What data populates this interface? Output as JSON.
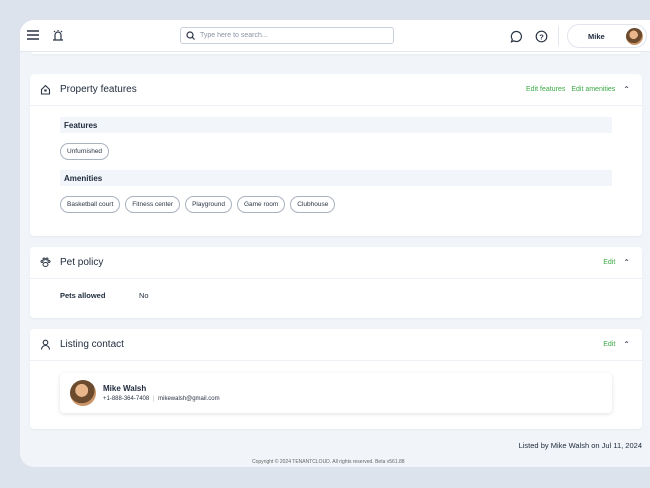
{
  "header": {
    "search_placeholder": "Type here to search...",
    "user_name": "Mike",
    "icons": [
      "menu-icon",
      "alarm-bell-icon",
      "search-icon",
      "chat-icon",
      "help-icon"
    ]
  },
  "property_features": {
    "title": "Property features",
    "edit_features": "Edit features",
    "edit_amenities": "Edit amenities",
    "features_label": "Features",
    "features": [
      "Unfurnished"
    ],
    "amenities_label": "Amenities",
    "amenities": [
      "Basketball court",
      "Fitness center",
      "Playground",
      "Game room",
      "Clubhouse"
    ]
  },
  "pet_policy": {
    "title": "Pet policy",
    "edit": "Edit",
    "label": "Pets allowed",
    "value": "No"
  },
  "listing_contact": {
    "title": "Listing contact",
    "edit": "Edit",
    "name": "Mike Walsh",
    "phone": "+1-888-364-7408",
    "separator": "|",
    "email": "mikewalsh@gmail.com"
  },
  "footer": {
    "listed_by": "Listed by Mike Walsh on Jul 11, 2024",
    "copyright": "Copyright © 2024 TENANTCLOUD. All rights reserved. Beta v561.88"
  },
  "colors": {
    "accent": "#3aa845",
    "background": "#dde3ec"
  }
}
